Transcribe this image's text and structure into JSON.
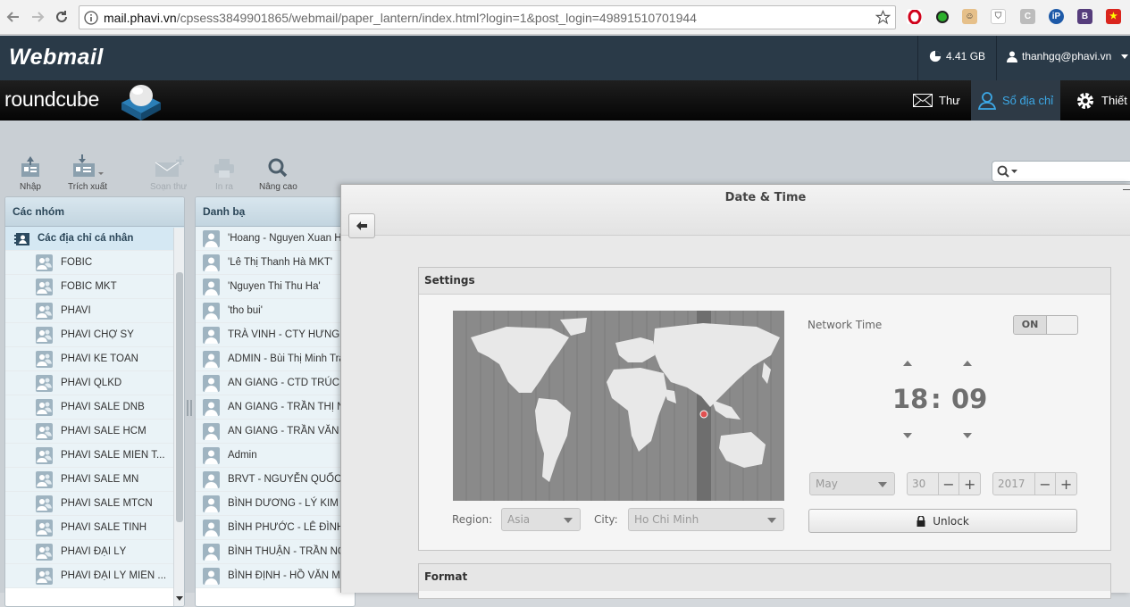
{
  "browser": {
    "url_host": "mail.phavi.vn",
    "url_path": "/cpsess3849901865/webmail/paper_lantern/index.html?login=1&post_login=49891510701944"
  },
  "header": {
    "brand": "Webmail",
    "disk_usage": "4.41 GB",
    "user": "thanhgq@phavi.vn"
  },
  "roundcube": {
    "logo": "roundcube",
    "nav": [
      {
        "label": "Thư",
        "icon": "envelope-icon"
      },
      {
        "label": "Sổ địa chỉ",
        "icon": "person-icon"
      },
      {
        "label": "Thiết",
        "icon": "gear-icon"
      }
    ]
  },
  "toolbar": {
    "import": "Nhập",
    "export": "Trích xuất",
    "compose": "Soạn thư",
    "print": "In ra",
    "advanced": "Nâng cao"
  },
  "groups": {
    "title": "Các nhóm",
    "root": "Các địa chỉ cá nhân",
    "items": [
      "FOBIC",
      "FOBIC MKT",
      "PHAVI",
      "PHAVI CHỢ SỸ",
      "PHAVI KE TOAN",
      "PHAVI QLKD",
      "PHAVI SALE DNB",
      "PHAVI SALE HCM",
      "PHAVI SALE MIỀN T...",
      "PHAVI SALE MN",
      "PHAVI SALE MTCN",
      "PHAVI SALE TỈNH",
      "PHAVI ĐẠI LÝ",
      "PHAVI ĐẠI LÝ MIỀN ..."
    ]
  },
  "contacts": {
    "title": "Danh bạ",
    "items": [
      "'Hoang - Nguyen Xuan Ho",
      "'Lê Thị Thanh Hà MKT'",
      "'Nguyen Thi Thu Ha'",
      "'tho bui'",
      "TRÀ VINH - CTY HƯNG T",
      "ADMIN - Bùi Thị Minh Tra",
      "AN GIANG - CTD TRÚC G",
      "AN GIANG - TRẦN THỊ N",
      "AN GIANG - TRẦN VĂN N",
      "Admin",
      "BRVT - NGUYỄN QUỐC T",
      "BÌNH DƯƠNG - LÝ KIM P",
      "BÌNH PHƯỚC - LÊ ĐÌNH",
      "BÌNH THUẬN - TRẦN NG",
      "BÌNH ĐỊNH - HỒ VĂN MỸ"
    ]
  },
  "dialog": {
    "title": "Date & Time",
    "settings_header": "Settings",
    "network_time_label": "Network Time",
    "network_time_state": "ON",
    "hour": "18",
    "separator": ":",
    "minute": "09",
    "month": "May",
    "day": "30",
    "year": "2017",
    "region_label": "Region:",
    "region": "Asia",
    "city_label": "City:",
    "city": "Ho Chi Minh",
    "unlock": "Unlock",
    "format_header": "Format"
  }
}
